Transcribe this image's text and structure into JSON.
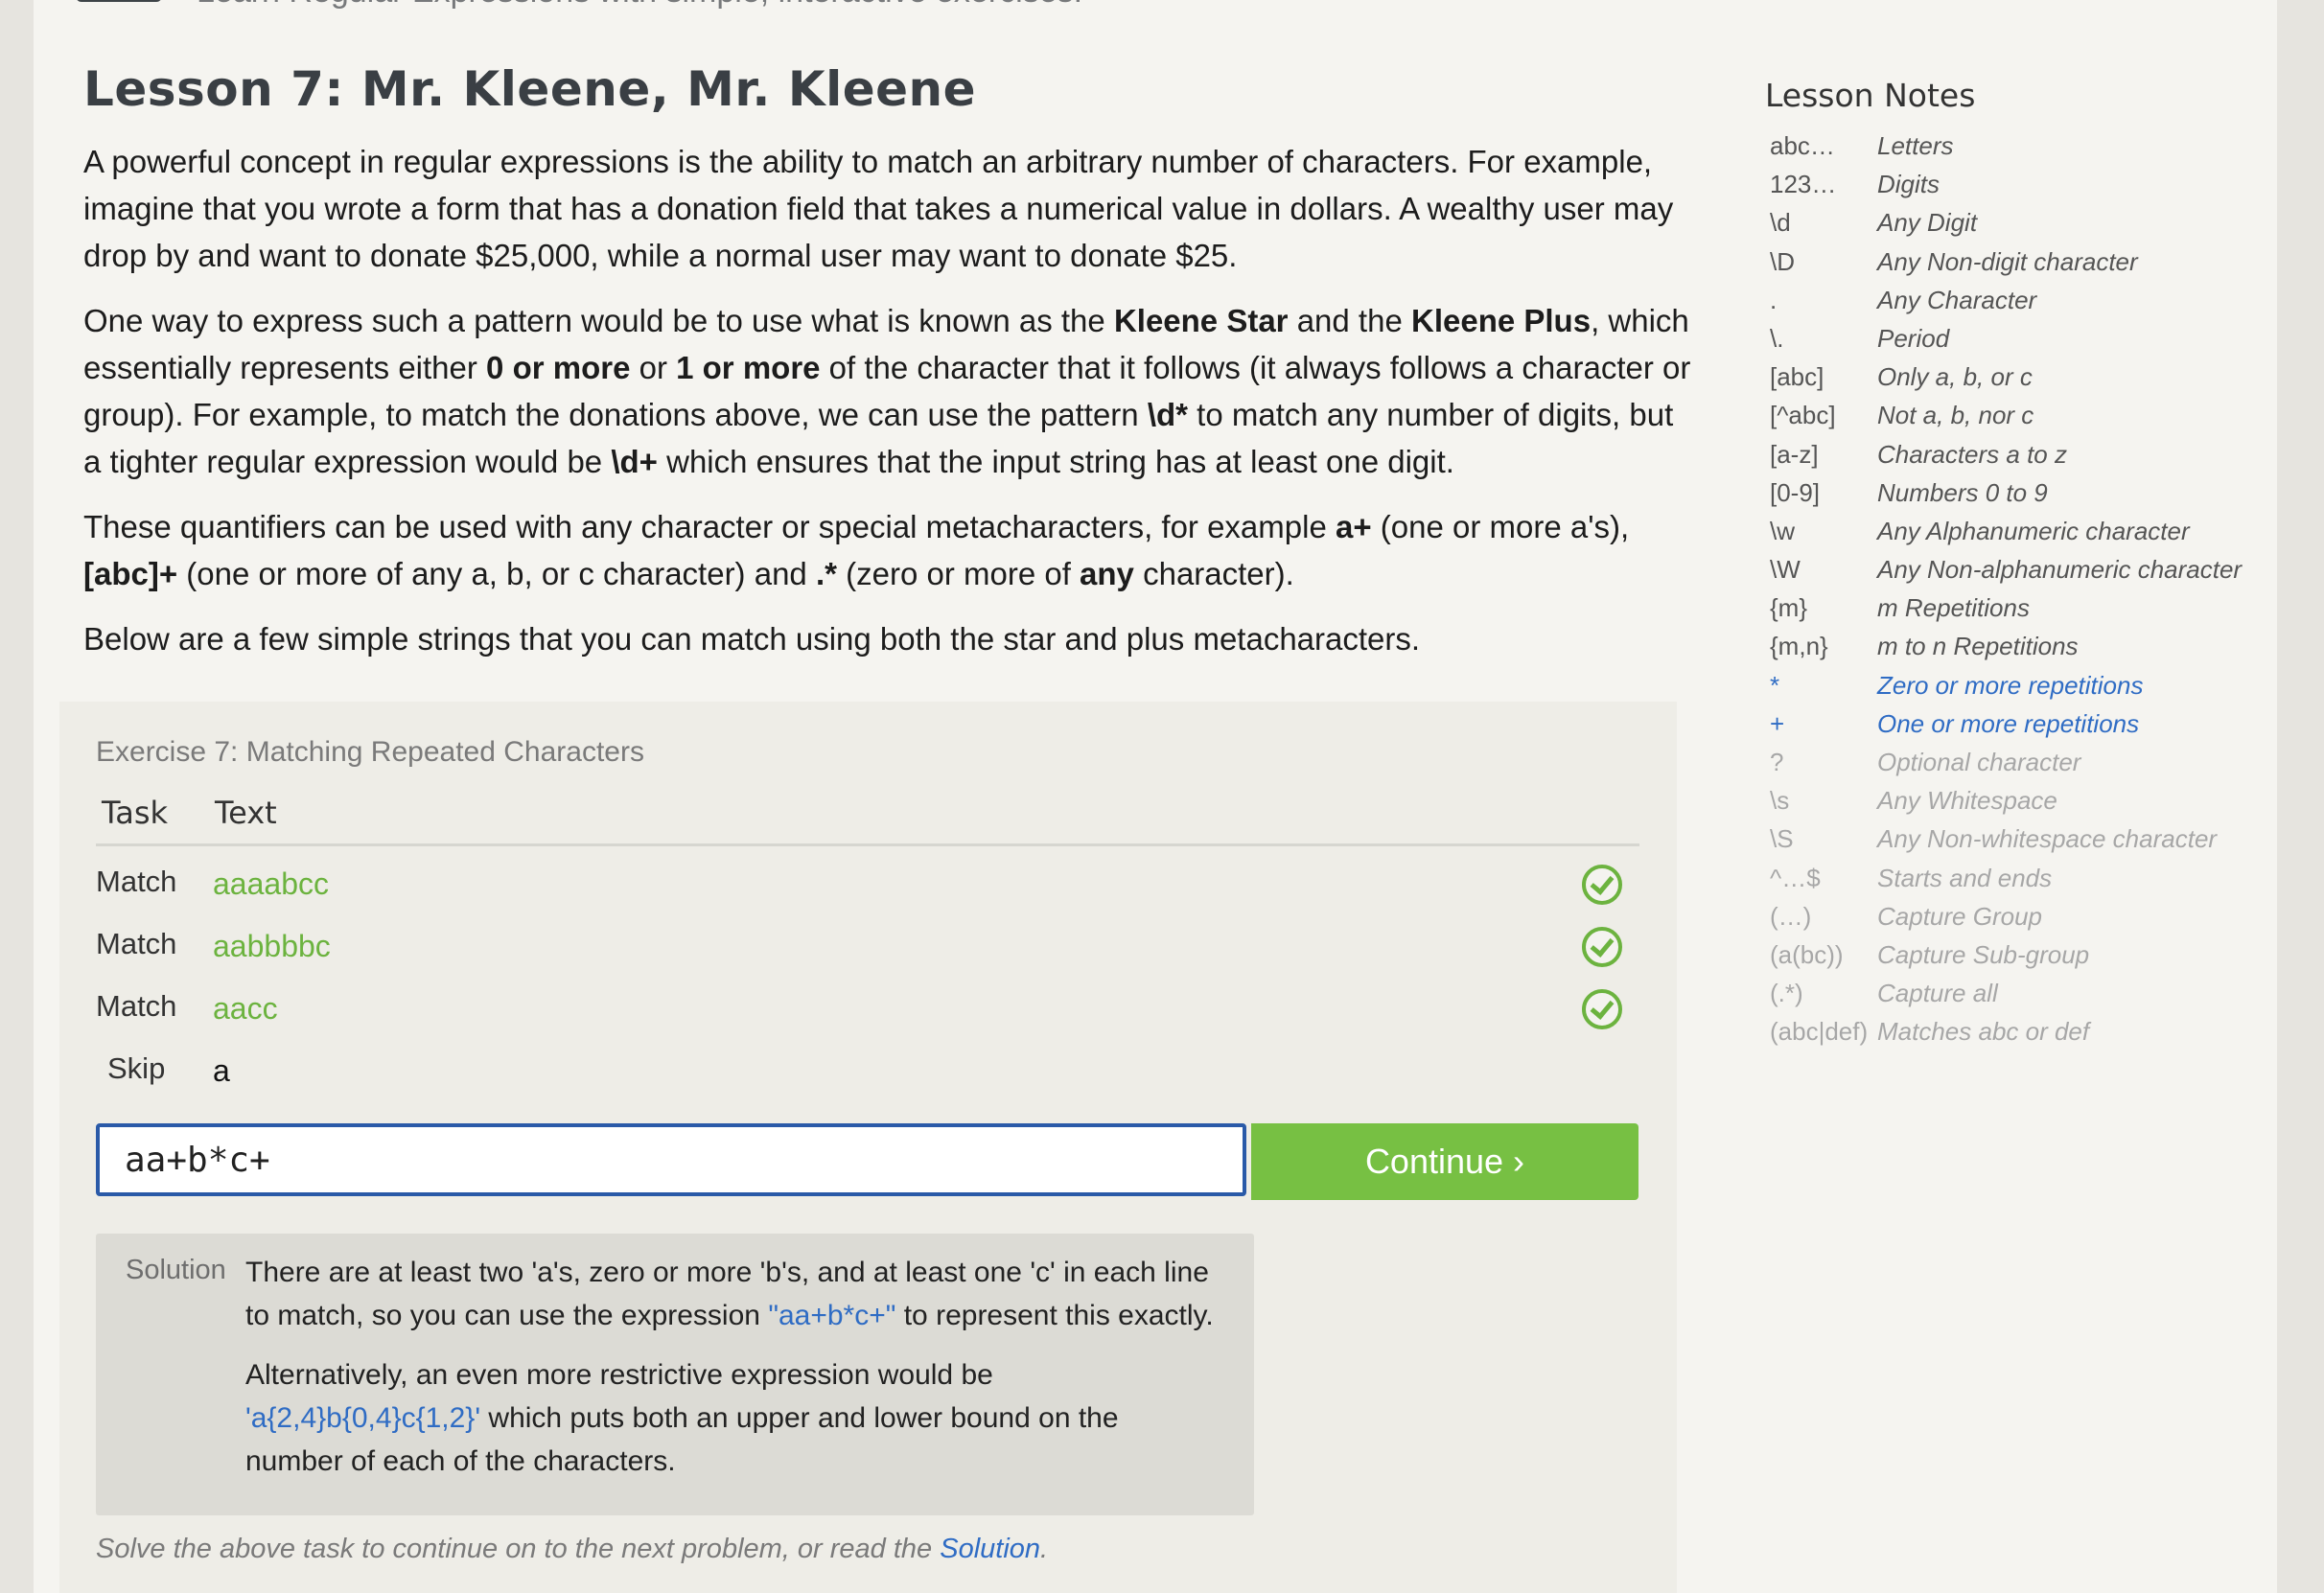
{
  "header": {
    "tagline": "Learn Regular Expressions with simple, interactive exercises."
  },
  "lesson": {
    "title": "Lesson 7: Mr. Kleene, Mr. Kleene",
    "p1": "A powerful concept in regular expressions is the ability to match an arbitrary number of characters. For example, imagine that you wrote a form that has a donation field that takes a numerical value in dollars. A wealthy user may drop by and want to donate $25,000, while a normal user may want to donate $25.",
    "p2": {
      "t1": "One way to express such a pattern would be to use what is known as the ",
      "b1": "Kleene Star",
      "t2": " and the ",
      "b2": "Kleene Plus",
      "t3": ", which essentially represents either ",
      "b3": "0 or more",
      "t4": " or ",
      "b4": "1 or more",
      "t5": " of the character that it follows (it always follows a character or group). For example, to match the donations above, we can use the pattern ",
      "b5": "\\d*",
      "t6": " to match any number of digits, but a tighter regular expression would be ",
      "b6": "\\d+",
      "t7": " which ensures that the input string has at least one digit."
    },
    "p3": {
      "t1": "These quantifiers can be used with any character or special metacharacters, for example ",
      "b1": "a+",
      "t2": " (one or more a's), ",
      "b2": "[abc]+",
      "t3": " (one or more of any a, b, or c character) and ",
      "b3": ".*",
      "t4": " (zero or more of ",
      "b4": "any",
      "t5": " character)."
    },
    "p4": "Below are a few simple strings that you can match using both the star and plus metacharacters."
  },
  "exercise": {
    "title": "Exercise 7: Matching Repeated Characters",
    "col_task": "Task",
    "col_text": "Text",
    "rows": [
      {
        "task": "Match",
        "text": "aaaabcc",
        "status": "matched"
      },
      {
        "task": "Match",
        "text": "aabbbbc",
        "status": "matched"
      },
      {
        "task": "Match",
        "text": "aacc",
        "status": "matched"
      },
      {
        "task": "Skip",
        "text": "a",
        "status": "skipped"
      }
    ],
    "input_value": "aa+b*c+",
    "continue_label": "Continue ›",
    "solution": {
      "label": "Solution",
      "s1a": "There are at least two 'a's, zero or more 'b's, and at least one 'c' in each line to match, so you can use the expression ",
      "s1code": "\"aa+b*c+\"",
      "s1b": " to represent this exactly.",
      "s2a": "Alternatively, an even more restrictive expression would be ",
      "s2code": "'a{2,4}b{0,4}c{1,2}'",
      "s2b": " which puts both an upper and lower bound on the number of each of the characters."
    },
    "footer_text": "Solve the above task to continue on to the next problem, or read the ",
    "footer_link": "Solution",
    "footer_end": "."
  },
  "notes": {
    "title": "Lesson Notes",
    "items": [
      {
        "sym": "abc…",
        "desc": "Letters",
        "state": "active"
      },
      {
        "sym": "123…",
        "desc": "Digits",
        "state": "active"
      },
      {
        "sym": "\\d",
        "desc": "Any Digit",
        "state": "active"
      },
      {
        "sym": "\\D",
        "desc": "Any Non-digit character",
        "state": "active"
      },
      {
        "sym": ".",
        "desc": "Any Character",
        "state": "active"
      },
      {
        "sym": "\\.",
        "desc": "Period",
        "state": "active"
      },
      {
        "sym": "[abc]",
        "desc": "Only a, b, or c",
        "state": "active"
      },
      {
        "sym": "[^abc]",
        "desc": "Not a, b, nor c",
        "state": "active"
      },
      {
        "sym": "[a-z]",
        "desc": "Characters a to z",
        "state": "active"
      },
      {
        "sym": "[0-9]",
        "desc": "Numbers 0 to 9",
        "state": "active"
      },
      {
        "sym": "\\w",
        "desc": "Any Alphanumeric character",
        "state": "active"
      },
      {
        "sym": "\\W",
        "desc": "Any Non-alphanumeric character",
        "state": "active"
      },
      {
        "sym": "{m}",
        "desc": "m Repetitions",
        "state": "active"
      },
      {
        "sym": "{m,n}",
        "desc": "m to n Repetitions",
        "state": "active"
      },
      {
        "sym": "*",
        "desc": "Zero or more repetitions",
        "state": "current"
      },
      {
        "sym": "+",
        "desc": "One or more repetitions",
        "state": "current"
      },
      {
        "sym": "?",
        "desc": "Optional character",
        "state": "future"
      },
      {
        "sym": "\\s",
        "desc": "Any Whitespace",
        "state": "future"
      },
      {
        "sym": "\\S",
        "desc": "Any Non-whitespace character",
        "state": "future"
      },
      {
        "sym": "^…$",
        "desc": "Starts and ends",
        "state": "future"
      },
      {
        "sym": "(…)",
        "desc": "Capture Group",
        "state": "future"
      },
      {
        "sym": "(a(bc))",
        "desc": "Capture Sub-group",
        "state": "future"
      },
      {
        "sym": "(.*)",
        "desc": "Capture all",
        "state": "future"
      },
      {
        "sym": "(abc|def)",
        "desc": "Matches abc or def",
        "state": "future"
      }
    ]
  },
  "colors": {
    "match_green": "#6cb33f",
    "button_green": "#77c043",
    "link_blue": "#2f6cc4",
    "input_border": "#2a5aa8"
  }
}
